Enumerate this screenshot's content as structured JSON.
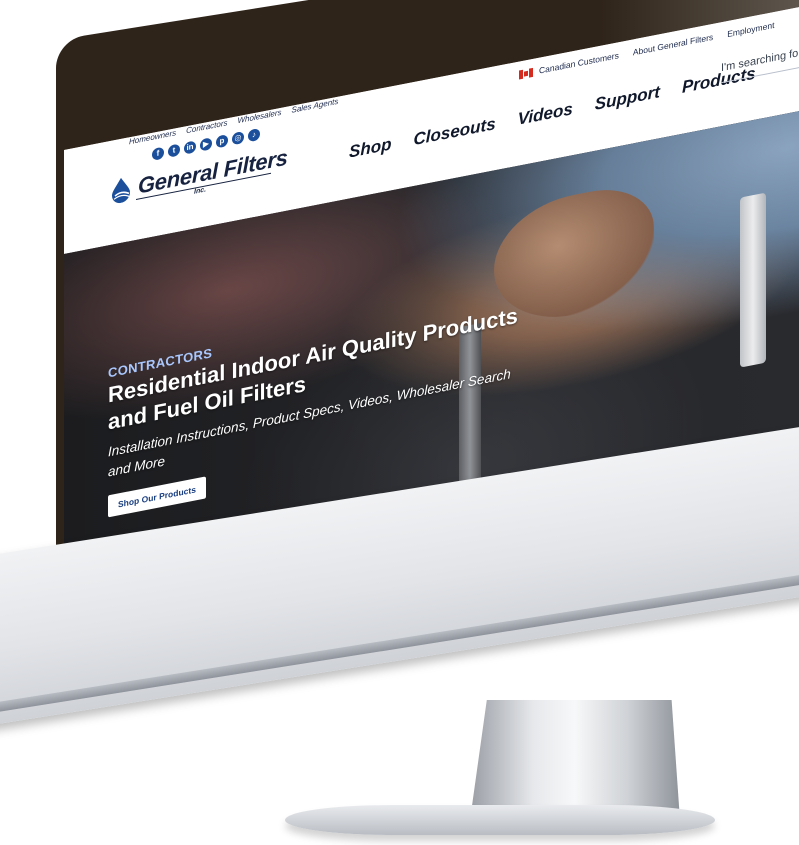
{
  "header": {
    "audience_links": [
      "Homeowners",
      "Contractors",
      "Wholesalers",
      "Sales Agents"
    ],
    "social_icons": [
      "facebook-icon",
      "twitter-icon",
      "linkedin-icon",
      "youtube-icon",
      "pinterest-icon",
      "instagram-icon",
      "tiktok-icon"
    ],
    "social_glyphs": [
      "f",
      "t",
      "in",
      "▶",
      "p",
      "◎",
      "♪"
    ],
    "logo_text": "General Filters",
    "logo_sub": "Inc.",
    "top_links": {
      "canadian": "Canadian Customers",
      "about": "About General Filters",
      "employment": "Employment"
    },
    "nav": [
      "Shop",
      "Closeouts",
      "Videos",
      "Support",
      "Products"
    ],
    "search_placeholder": "I'm searching for"
  },
  "hero": {
    "eyebrow": "CONTRACTORS",
    "title": "Residential Indoor Air Quality Products and Fuel Oil Filters",
    "subtitle": "Installation Instructions, Product Specs, Videos, Wholesaler Search and More",
    "cta": "Shop Our Products"
  },
  "colors": {
    "bezel": "#2f2419",
    "brand_blue": "#1b4f9c",
    "eyebrow": "#a9c8ff",
    "cta_text": "#1b3f80"
  }
}
